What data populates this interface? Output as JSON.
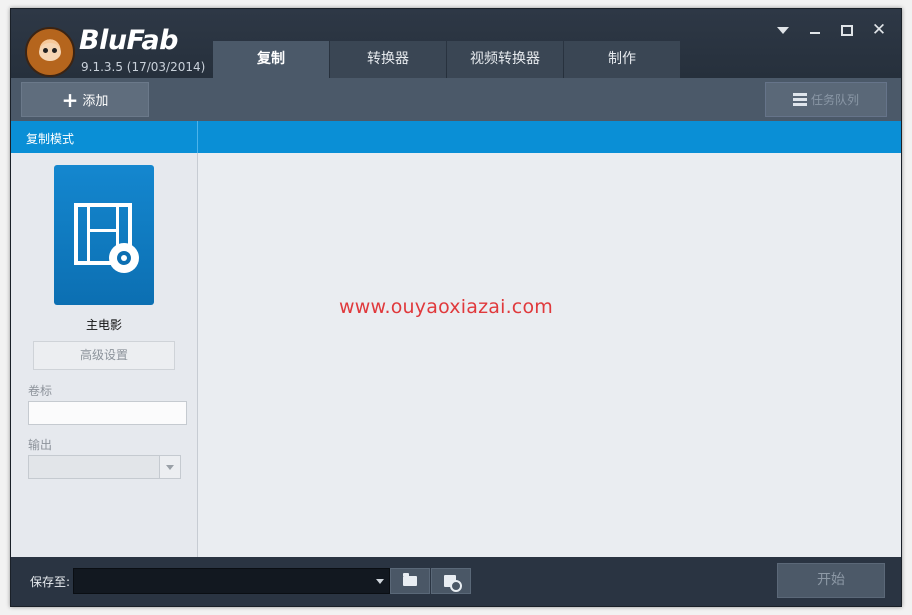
{
  "app": {
    "name": "BluFab",
    "version": "9.1.3.5 (17/03/2014)"
  },
  "tabs": [
    {
      "label": "复制",
      "active": true
    },
    {
      "label": "转换器",
      "active": false
    },
    {
      "label": "视频转换器",
      "active": false
    },
    {
      "label": "制作",
      "active": false
    }
  ],
  "window_controls": {
    "menu_icon": "dropdown-triangle-icon",
    "minimize_icon": "minimize-icon",
    "maximize_icon": "maximize-icon",
    "close_label": "✕"
  },
  "toolbar": {
    "add_label": "添加",
    "add_glyph": "+",
    "queue_label": "任务队列"
  },
  "band": {
    "title": "复制模式"
  },
  "left_panel": {
    "mode_name": "主电影",
    "advanced_label": "高级设置",
    "volume_label": "卷标",
    "volume_value": "",
    "output_label": "输出",
    "output_value": ""
  },
  "main": {
    "watermark": "www.ouyaoxiazai.com"
  },
  "footer": {
    "save_to_label": "保存至:",
    "save_path": "",
    "start_label": "开始"
  },
  "colors": {
    "accent_blue": "#0a8fd6",
    "header_dark": "#2a3340",
    "watermark_red": "#e0393c"
  }
}
